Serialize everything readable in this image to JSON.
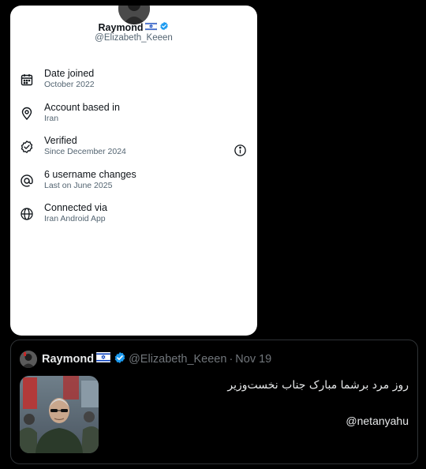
{
  "about_card": {
    "name": "Raymond",
    "handle": "@Elizabeth_Keeen",
    "rows": [
      {
        "icon": "calendar-icon",
        "title": "Date joined",
        "subtitle": "October 2022"
      },
      {
        "icon": "location-pin-icon",
        "title": "Account based in",
        "subtitle": "Iran"
      },
      {
        "icon": "verified-badge-outline-icon",
        "title": "Verified",
        "subtitle": "Since December 2024",
        "extra_icon": "info-icon"
      },
      {
        "icon": "at-sign-icon",
        "title": "6 username changes",
        "subtitle": "Last on June 2025"
      },
      {
        "icon": "globe-icon",
        "title": "Connected via",
        "subtitle": "Iran Android App"
      }
    ]
  },
  "tweet": {
    "name": "Raymond",
    "handle": "@Elizabeth_Keeen",
    "separator": "·",
    "date": "Nov 19",
    "text": "روز مرد برشما مبارک جناب نخست‌وزیر",
    "mention": "@netanyahu"
  },
  "colors": {
    "verified": "#1d9bf0",
    "flag_blue": "#0038b8",
    "background": "#000000",
    "card": "#ffffff",
    "muted": "#536471"
  }
}
